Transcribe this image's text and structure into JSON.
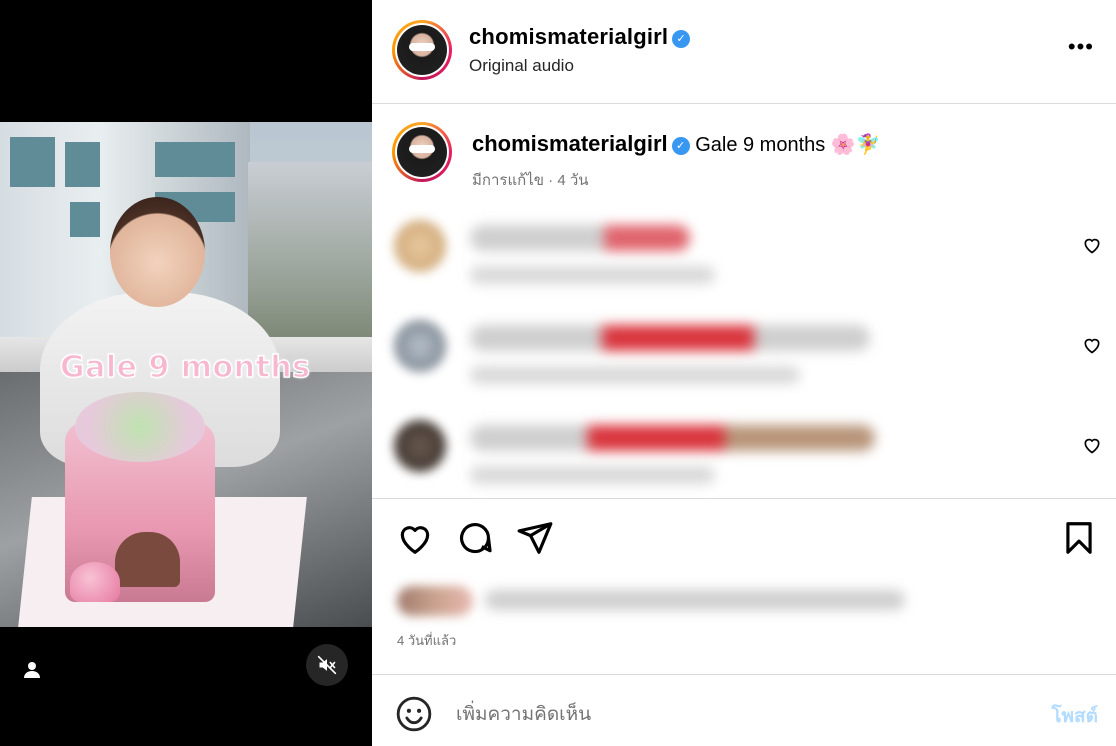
{
  "media": {
    "overlay_caption": "Gale 9 months",
    "user_tag_icon": "person-icon",
    "mute_icon": "speaker-muted-icon"
  },
  "header": {
    "username": "chomismaterialgirl",
    "verified_icon": "verified-badge-icon",
    "audio": "Original audio",
    "more_icon": "more-horizontal-icon",
    "more_label": "•••"
  },
  "caption": {
    "username": "chomismaterialgirl",
    "text": "Gale 9 months 🌸🧚‍♀️",
    "meta": "มีการแก้ไข · 4 วัน"
  },
  "comments": [
    {
      "blurred": true,
      "accent": "#e06a72"
    },
    {
      "blurred": true,
      "accent": "#d9363e"
    },
    {
      "blurred": true,
      "accent": "#c99a7a"
    }
  ],
  "actions": {
    "like_icon": "heart-icon",
    "comment_icon": "comment-bubble-icon",
    "share_icon": "paper-plane-icon",
    "save_icon": "bookmark-icon"
  },
  "likes": {
    "blurred": true
  },
  "time": "4 วันที่แล้ว",
  "add_comment": {
    "emoji_icon": "emoji-smile-icon",
    "placeholder": "เพิ่มความคิดเห็น",
    "post_label": "โพสต์"
  },
  "colors": {
    "accent_blue": "#3897f0",
    "post_disabled": "#b3dbff",
    "border": "#dbdbdb"
  }
}
